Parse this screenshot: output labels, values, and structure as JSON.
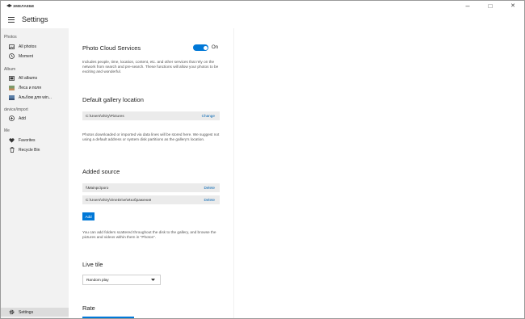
{
  "titlebar": {
    "brand": "ЭМЕЛАЕБЕ",
    "controls": [
      {
        "name": "minimize-button",
        "glyph": "–"
      },
      {
        "name": "maximize-button",
        "glyph": "□"
      },
      {
        "name": "close-button",
        "glyph": "✕"
      }
    ]
  },
  "header": {
    "title": "Settings"
  },
  "sidebar": {
    "sections": [
      {
        "label": "Photos"
      },
      {
        "label": "Album"
      },
      {
        "label": "device/import"
      },
      {
        "label": "Me"
      }
    ],
    "items": [
      {
        "label": "All photos",
        "icon": "photo-icon"
      },
      {
        "label": "Moment",
        "icon": "clock-icon"
      },
      {
        "label": "All albums",
        "icon": "album-icon"
      },
      {
        "label": "Леса и поля",
        "icon": "album-thumb-icon"
      },
      {
        "label": "Альбом для win...",
        "icon": "album-thumb-icon"
      },
      {
        "label": "Add",
        "icon": "add-icon"
      },
      {
        "label": "Favorites",
        "icon": "heart-icon"
      },
      {
        "label": "Recycle Bin",
        "icon": "trash-icon"
      }
    ],
    "settings": {
      "label": "Settings",
      "icon": "gear-icon"
    }
  },
  "main": {
    "cloud": {
      "title": "Photo Cloud Services",
      "toggle_state": "On",
      "toggle_on": true,
      "description": "Includes people, time, location, content, etc. and other services that rely on the network from search and pre-search. These functions will allow your photos to be exciting and wonderful."
    },
    "gallery": {
      "title": "Default gallery location",
      "path": "C:\\Users\\shiry\\Pictures",
      "action": "Change",
      "description": "Photos downloaded or imported via data lines will be stored here. We suggest not using a default address or system disk partitions as the gallery's location."
    },
    "sources": {
      "title": "Added source",
      "items": [
        {
          "path": "\\\\Mainpc\\porо",
          "action": "Delete"
        },
        {
          "path": "C:\\Users\\shiry\\OneDrive\\Изображения",
          "action": "Delete"
        }
      ],
      "add_label": "Add",
      "description": "You can add folders scattered throughout the disk to the gallery, and browse the pictures and videos within them in \"Photos\"."
    },
    "live_tile": {
      "title": "Live tile",
      "selected": "Random play"
    },
    "rate": {
      "title": "Rate"
    }
  },
  "colors": {
    "accent": "#0078d7",
    "link": "#0063b1",
    "sidebar_bg": "#f2f2f2"
  }
}
